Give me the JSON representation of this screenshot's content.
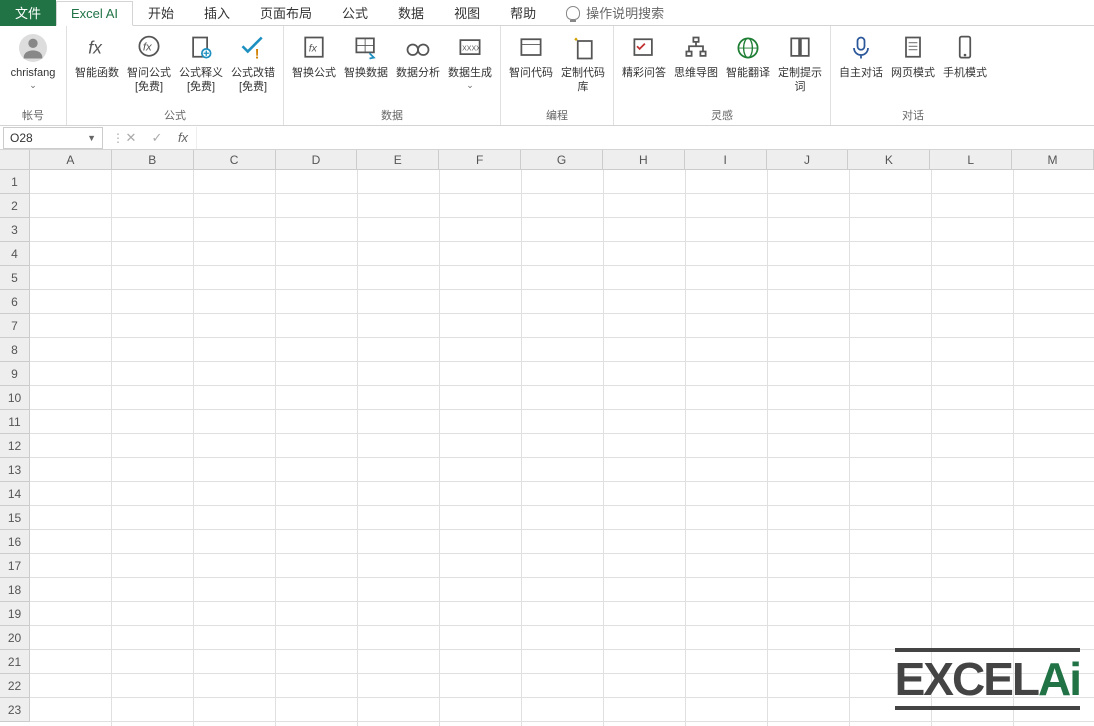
{
  "tabs": {
    "file": "文件",
    "items": [
      "Excel AI",
      "开始",
      "插入",
      "页面布局",
      "公式",
      "数据",
      "视图",
      "帮助"
    ],
    "search": "操作说明搜索",
    "activeIndex": 0
  },
  "ribbon": {
    "account": {
      "username": "chrisfang",
      "groupLabel": "帐号"
    },
    "groups": [
      {
        "label": "公式",
        "items": [
          {
            "key": "smart-func",
            "label": "智能函数",
            "icon": "fx",
            "sub": ""
          },
          {
            "key": "ask-formula",
            "label": "智问公式\n[免费]",
            "icon": "fx-circle"
          },
          {
            "key": "formula-explain",
            "label": "公式释义\n[免费]",
            "icon": "doc-gear"
          },
          {
            "key": "formula-fix",
            "label": "公式改错\n[免费]",
            "icon": "check-warn"
          }
        ]
      },
      {
        "label": "数据",
        "items": [
          {
            "key": "swap-formula",
            "label": "智换公式",
            "icon": "doc-fx"
          },
          {
            "key": "swap-data",
            "label": "智换数据",
            "icon": "grid-arrow"
          },
          {
            "key": "analyze",
            "label": "数据分析",
            "icon": "glasses"
          },
          {
            "key": "generate",
            "label": "数据生成",
            "icon": "xxxx"
          }
        ]
      },
      {
        "label": "编程",
        "items": [
          {
            "key": "ask-code",
            "label": "智问代码",
            "icon": "window"
          },
          {
            "key": "code-lib",
            "label": "定制代码库",
            "icon": "sparkle-doc"
          }
        ]
      },
      {
        "label": "灵感",
        "items": [
          {
            "key": "qa",
            "label": "精彩问答",
            "icon": "grid-check"
          },
          {
            "key": "mindmap",
            "label": "思维导图",
            "icon": "tree"
          },
          {
            "key": "translate",
            "label": "智能翻译",
            "icon": "globe"
          },
          {
            "key": "prompts",
            "label": "定制提示词",
            "icon": "book"
          }
        ]
      },
      {
        "label": "对话",
        "items": [
          {
            "key": "auto-chat",
            "label": "自主对话",
            "icon": "mic"
          },
          {
            "key": "web-mode",
            "label": "网页模式",
            "icon": "page"
          },
          {
            "key": "mobile-mode",
            "label": "手机模式",
            "icon": "phone"
          }
        ]
      }
    ]
  },
  "formulaBar": {
    "nameBox": "O28",
    "formula": ""
  },
  "grid": {
    "columns": [
      "A",
      "B",
      "C",
      "D",
      "E",
      "F",
      "G",
      "H",
      "I",
      "J",
      "K",
      "L",
      "M"
    ],
    "rows": [
      "1",
      "2",
      "3",
      "4",
      "5",
      "6",
      "7",
      "8",
      "9",
      "10",
      "11",
      "12",
      "13",
      "14",
      "15",
      "16",
      "17",
      "18",
      "19",
      "20",
      "21",
      "22",
      "23"
    ]
  },
  "watermark": {
    "text_main": "EXCEL",
    "text_ai": "Ai"
  }
}
